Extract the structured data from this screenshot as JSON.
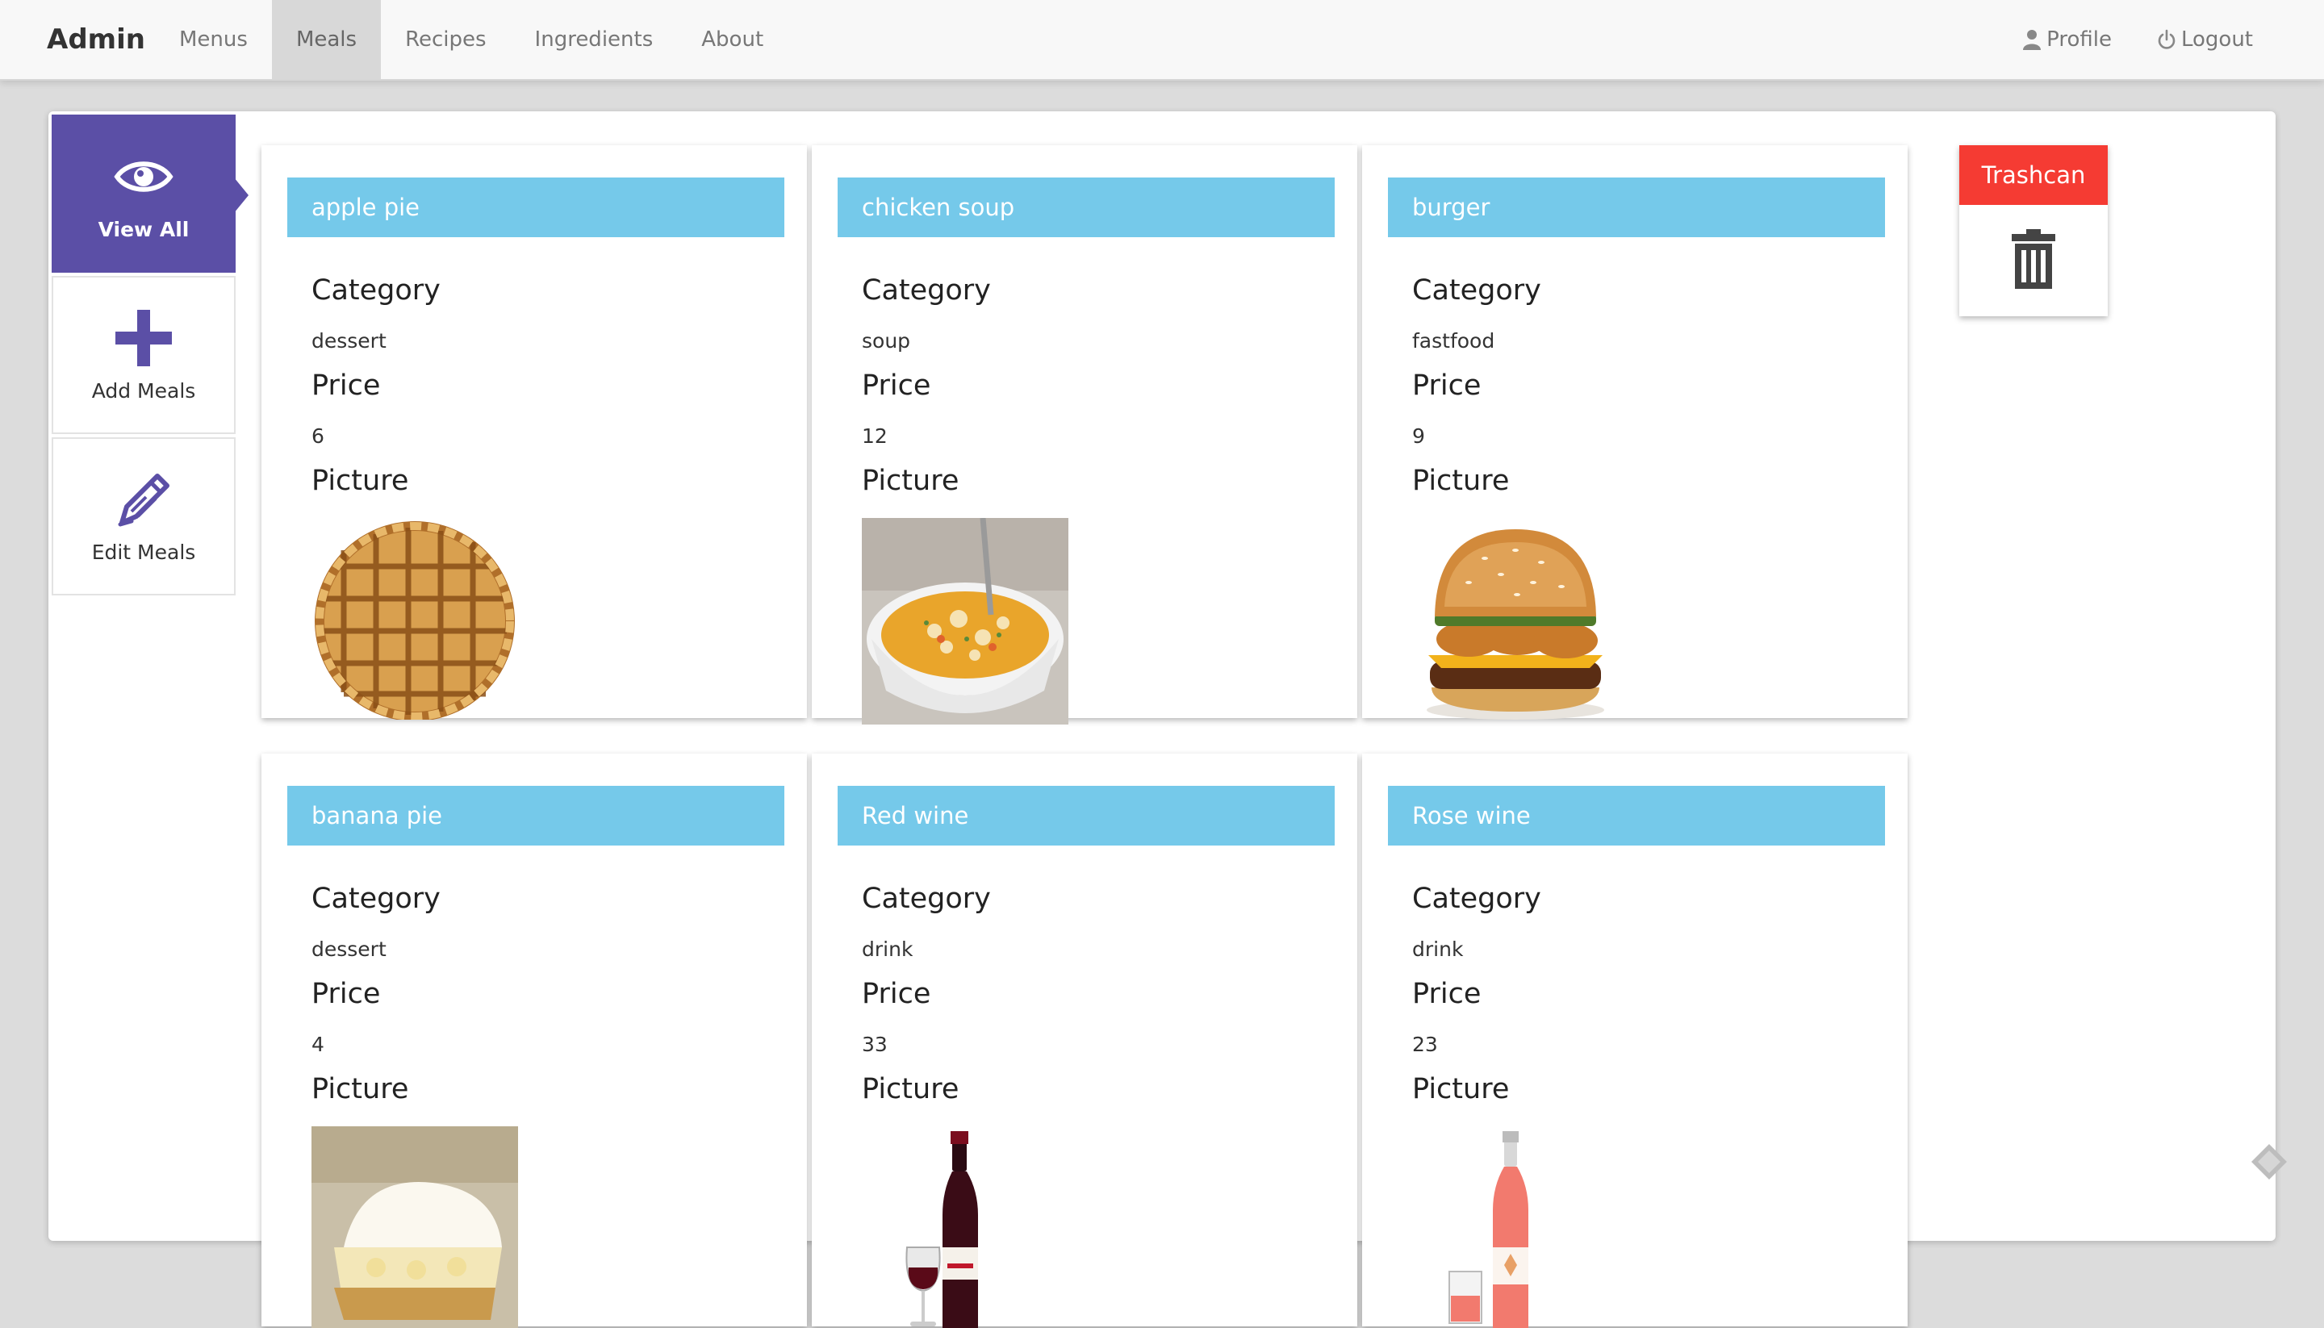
{
  "brand": "Admin",
  "nav": {
    "items": [
      {
        "label": "Menus"
      },
      {
        "label": "Meals"
      },
      {
        "label": "Recipes"
      },
      {
        "label": "Ingredients"
      },
      {
        "label": "About"
      }
    ],
    "active": "Meals",
    "profile_label": "Profile",
    "logout_label": "Logout"
  },
  "sidebar": {
    "items": [
      {
        "label": "View All",
        "icon": "eye-icon"
      },
      {
        "label": "Add Meals",
        "icon": "plus-icon"
      },
      {
        "label": "Edit Meals",
        "icon": "pen-icon"
      }
    ],
    "accent_color": "#5b4fa6"
  },
  "field_labels": {
    "category": "Category",
    "price": "Price",
    "picture": "Picture"
  },
  "meals": [
    {
      "name": "apple pie",
      "category": "dessert",
      "price": "6",
      "picture": "apple-pie-image"
    },
    {
      "name": "chicken soup",
      "category": "soup",
      "price": "12",
      "picture": "chicken-soup-image"
    },
    {
      "name": "burger",
      "category": "fastfood",
      "price": "9",
      "picture": "burger-image"
    },
    {
      "name": "banana pie",
      "category": "dessert",
      "price": "4",
      "picture": "banana-pie-image"
    },
    {
      "name": "Red wine",
      "category": "drink",
      "price": "33",
      "picture": "red-wine-image"
    },
    {
      "name": "Rose wine",
      "category": "drink",
      "price": "23",
      "picture": "rose-wine-image"
    }
  ],
  "trash": {
    "label": "Trashcan",
    "icon": "trash-icon",
    "color": "#f53b33"
  },
  "colors": {
    "card_header": "#75c9ea",
    "nav_background": "#f8f8f8"
  }
}
